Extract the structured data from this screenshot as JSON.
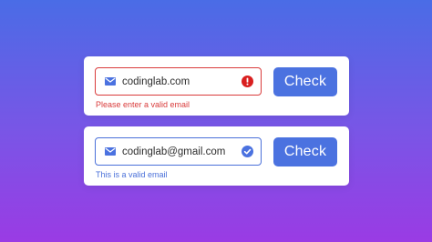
{
  "colors": {
    "error": "#d93b3b",
    "valid": "#4a70d9",
    "button": "#4b72e0",
    "icon": "#4b72e0"
  },
  "forms": [
    {
      "email_value": "codinglab.com",
      "leading_icon": "mail-icon",
      "status_icon": "error-icon",
      "state": "invalid",
      "button_label": "Check",
      "message": "Please enter a valid email"
    },
    {
      "email_value": "codinglab@gmail.com",
      "leading_icon": "mail-icon",
      "status_icon": "check-circle-icon",
      "state": "valid",
      "button_label": "Check",
      "message": "This is a valid email"
    }
  ]
}
